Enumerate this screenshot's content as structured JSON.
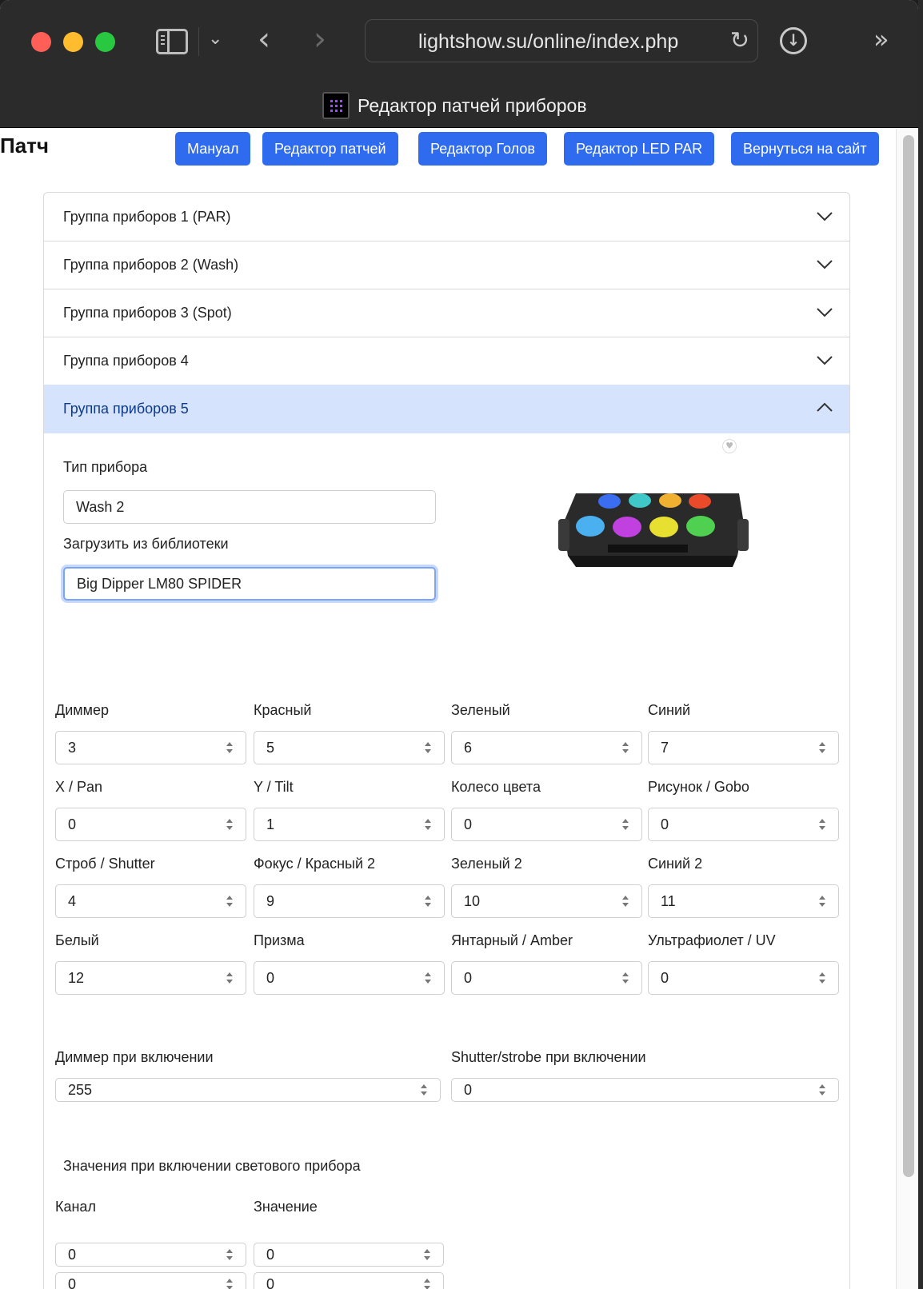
{
  "browser": {
    "url": "lightshow.su/online/index.php",
    "tab_title": "Редактор патчей приборов"
  },
  "page": {
    "title": "Патч",
    "nav_buttons": [
      "Мануал",
      "Редактор патчей",
      "Редактор Голов",
      "Редактор LED PAR",
      "Вернуться на сайт"
    ]
  },
  "accordion": {
    "groups": [
      {
        "label": "Группа приборов 1 (PAR)",
        "expanded": false
      },
      {
        "label": "Группа приборов 2 (Wash)",
        "expanded": false
      },
      {
        "label": "Группа приборов 3 (Spot)",
        "expanded": false
      },
      {
        "label": "Группа приборов 4",
        "expanded": false
      },
      {
        "label": "Группа приборов 5",
        "expanded": true
      }
    ]
  },
  "group5": {
    "fixture_type_label": "Тип прибора",
    "fixture_type_value": "Wash 2",
    "library_label": "Загрузить из библиотеки",
    "library_value": "Big Dipper LM80 SPIDER",
    "channels": [
      {
        "label": "Диммер",
        "value": "3"
      },
      {
        "label": "Красный",
        "value": "5"
      },
      {
        "label": "Зеленый",
        "value": "6"
      },
      {
        "label": "Синий",
        "value": "7"
      },
      {
        "label": "X / Pan",
        "value": "0"
      },
      {
        "label": "Y / Tilt",
        "value": "1"
      },
      {
        "label": "Колесо цвета",
        "value": "0"
      },
      {
        "label": "Рисунок / Gobo",
        "value": "0"
      },
      {
        "label": "Строб / Shutter",
        "value": "4"
      },
      {
        "label": "Фокус / Красный 2",
        "value": "9"
      },
      {
        "label": "Зеленый 2",
        "value": "10"
      },
      {
        "label": "Синий 2",
        "value": "11"
      },
      {
        "label": "Белый",
        "value": "12"
      },
      {
        "label": "Призма",
        "value": "0"
      },
      {
        "label": "Янтарный / Amber",
        "value": "0"
      },
      {
        "label": "Ультрафиолет / UV",
        "value": "0"
      }
    ],
    "dimmer_on_label": "Диммер при включении",
    "dimmer_on_value": "255",
    "shutter_on_label": "Shutter/strobe при включении",
    "shutter_on_value": "0",
    "startup_values_title": "Значения при включении светового прибора",
    "startup_channel_header": "Канал",
    "startup_value_header": "Значение",
    "startup_rows": [
      {
        "channel": "0",
        "value": "0"
      },
      {
        "channel": "0",
        "value": "0"
      }
    ]
  },
  "colors": {
    "accent": "#2f6bef",
    "active_group_bg": "#d6e3fc"
  },
  "icons": [
    "sidebar-icon",
    "chevron-down-icon",
    "back-icon",
    "forward-icon",
    "reload-icon",
    "download-icon",
    "more-icon",
    "heart-icon"
  ]
}
